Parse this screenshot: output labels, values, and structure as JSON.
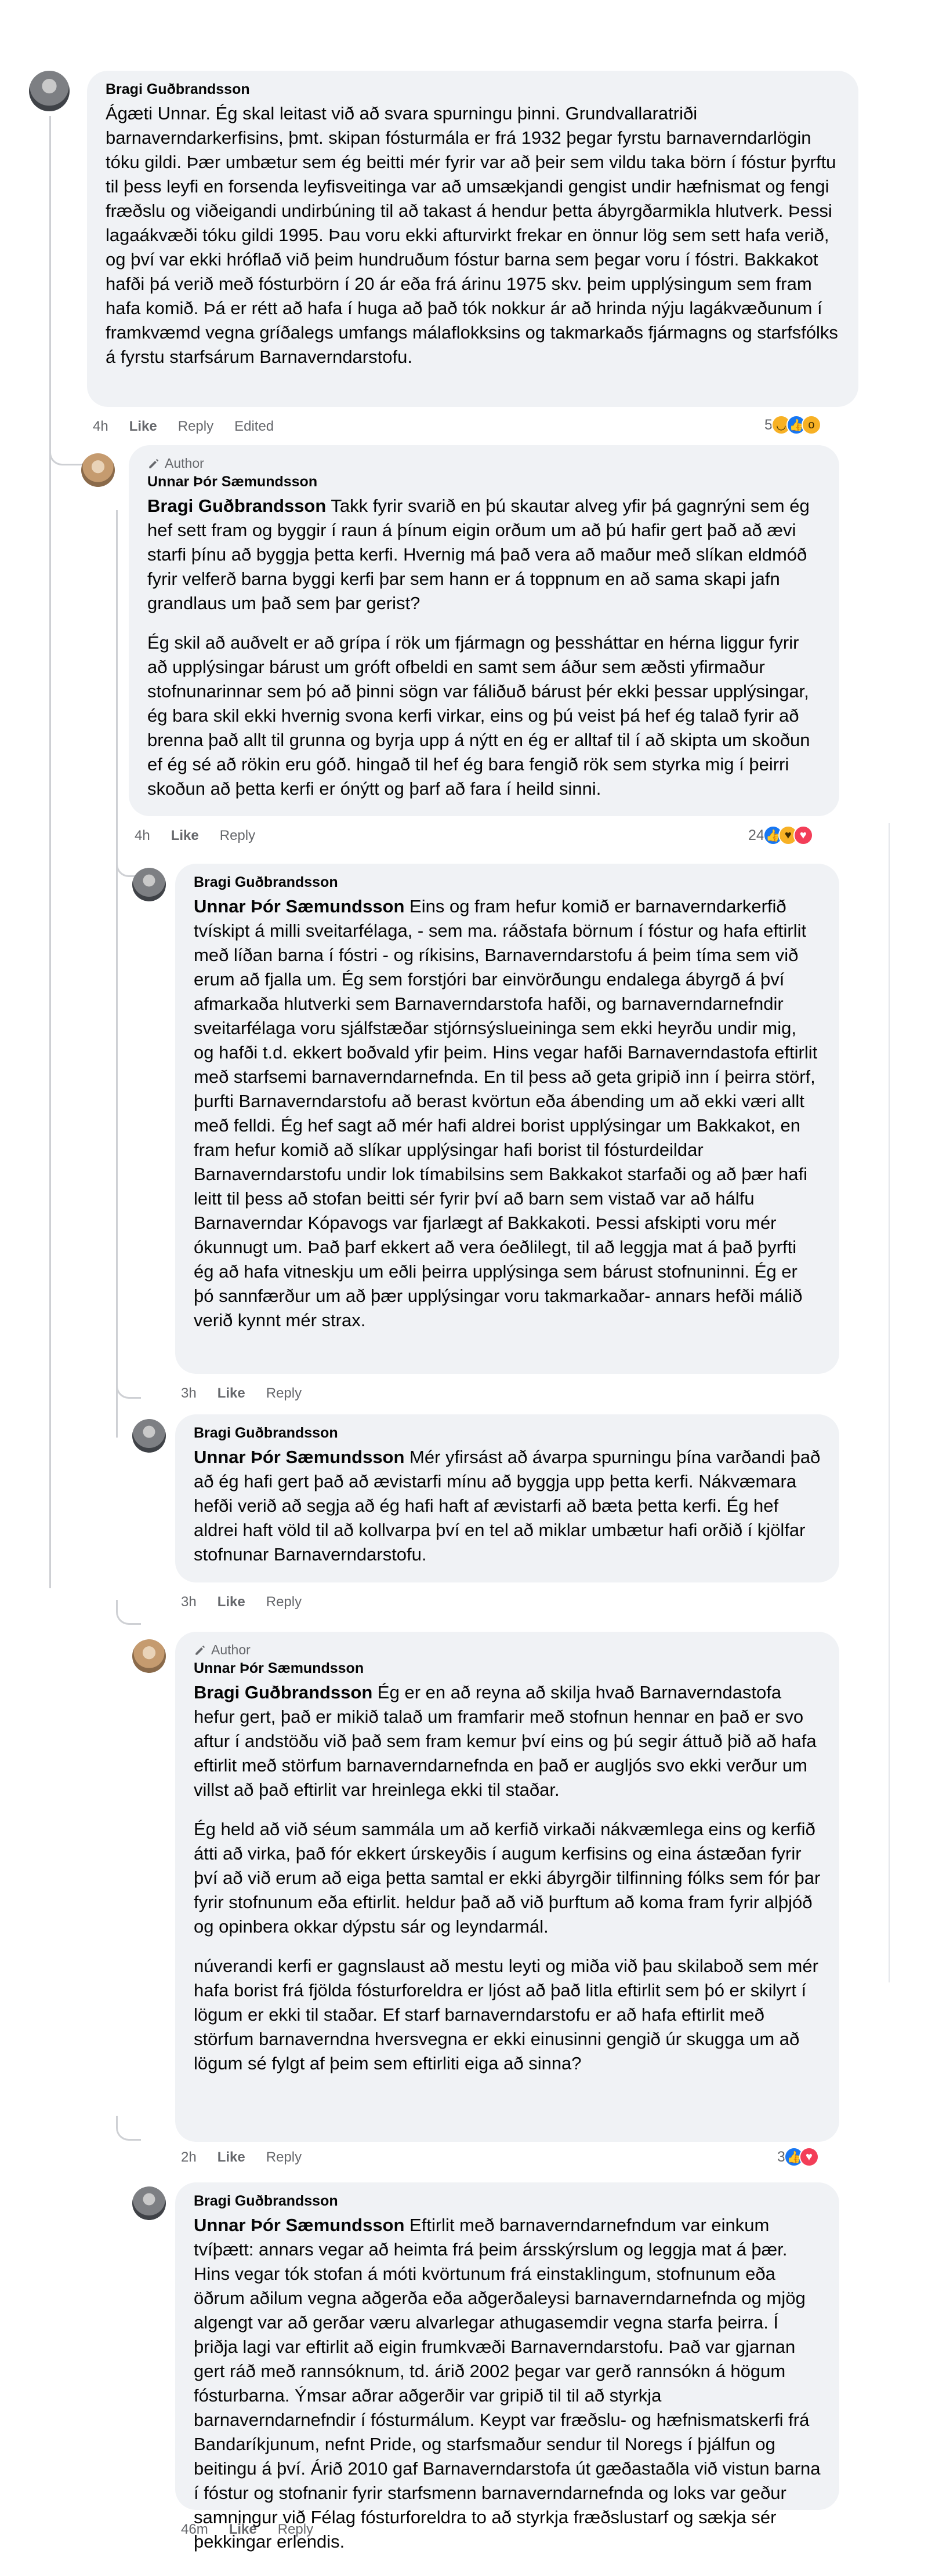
{
  "comments": [
    {
      "author": "Bragi Guðbrandsson",
      "author_badge": "",
      "mention": "",
      "paragraphs": [
        "Ágæti Unnar. Ég skal leitast við að svara spurningu þinni. Grundvallaratriði barnaverndarkerfisins, þmt. skipan fósturmála er frá 1932 þegar fyrstu barnaverndarlögin tóku gildi. Þær umbætur sem ég beitti mér fyrir var að þeir sem vildu taka börn í fóstur þyrftu til þess leyfi en forsenda leyfisveitinga var að umsækjandi gengist undir hæfnismat og fengi fræðslu og viðeigandi undirbúning til að takast á hendur þetta ábyrgðarmikla hlutverk. Þessi lagaákvæði tóku gildi 1995. Þau voru ekki afturvirkt frekar en önnur lög sem sett hafa verið, og því var ekki hróflað við þeim hundruðum fóstur barna sem þegar voru í fóstri. Bakkakot hafði þá verið með fósturbörn í 20 ár eða frá árinu 1975 skv. þeim upplýsingum sem fram hafa komið. Þá er rétt að hafa í huga að það tók nokkur ár að hrinda nýju lagákvæðunum í framkvæmd vegna gríðalegs umfangs málaflokksins og takmarkaðs fjármagns og starfsfólks á fyrstu starfsárum Barnaverndarstofu."
      ],
      "time": "4h",
      "like_label": "Like",
      "reply_label": "Reply",
      "edited_label": "Edited",
      "reaction_count": "5",
      "reactions": [
        "haha",
        "like",
        "wow"
      ]
    },
    {
      "author": "Unnar Þór Sæmundsson",
      "author_badge": "Author",
      "mention": "Bragi Guðbrandsson",
      "paragraphs": [
        " Takk fyrir svarið en þú skautar alveg yfir þá gagnrýni sem ég hef sett fram og byggir í raun á þínum eigin orðum um að þú hafir gert það að ævi starfi þínu að byggja þetta kerfi. Hvernig má það vera að maður með slíkan eldmóð fyrir velferð barna byggi kerfi þar sem hann er á toppnum en að sama skapi jafn grandlaus um það sem þar gerist?",
        "Ég skil að auðvelt er að grípa í rök um fjármagn og þessháttar en hérna liggur fyrir að upplýsingar bárust um gróft ofbeldi en samt sem áður sem æðsti yfirmaður stofnunarinnar sem þó að þinni sögn var fáliðuð bárust þér ekki þessar upplýsingar, ég bara skil ekki hvernig svona kerfi virkar, eins og þú veist þá hef ég talað fyrir að brenna það allt til grunna og byrja upp á nýtt en ég er alltaf til í að skipta um skoðun ef ég sé að rökin eru góð. hingað til hef ég bara fengið rök sem styrka mig í þeirri skoðun að þetta kerfi er ónýtt og þarf að fara í heild sinni."
      ],
      "time": "4h",
      "like_label": "Like",
      "reply_label": "Reply",
      "reaction_count": "24",
      "reactions": [
        "like",
        "care",
        "love"
      ]
    },
    {
      "author": "Bragi Guðbrandsson",
      "author_badge": "",
      "mention": "Unnar Þór Sæmundsson",
      "paragraphs": [
        " Eins og fram hefur komið er barnaverndarkerfið tvískipt á milli sveitarfélaga, - sem ma. ráðstafa börnum í fóstur og hafa eftirlit með líðan barna í fóstri - og ríkisins, Barnaverndarstofu á þeim tíma sem við erum að fjalla um. Ég sem forstjóri bar einvörðungu endalega ábyrgð á því afmarkaða hlutverki sem Barnaverndarstofa hafði, og barnaverndarnefndir sveitarfélaga voru sjálfstæðar stjórnsýslueininga sem ekki heyrðu undir mig, og hafði t.d. ekkert boðvald yfir þeim. Hins vegar hafði Barnaverndastofa eftirlit með starfsemi barnaverndarnefnda. En til þess að geta gripið inn í þeirra störf, þurfti Barnaverndarstofu að berast kvörtun eða ábending um að ekki væri allt með felldi. Ég hef sagt að mér hafi aldrei borist upplýsingar um Bakkakot, en fram hefur komið að slíkar upplýsingar hafi borist til fósturdeildar Barnaverndarstofu undir lok tímabilsins sem Bakkakot starfaði og að þær hafi leitt til þess að stofan beitti sér fyrir því að barn sem vistað var að hálfu Barnaverndar Kópavogs var fjarlægt af Bakkakoti. Þessi afskipti voru mér ókunnugt um. Það þarf ekkert að vera óeðlilegt, til að leggja mat á það þyrfti ég að hafa vitneskju um eðli þeirra upplýsinga sem bárust stofnuninni. Ég er þó sannfærður um að þær upplýsingar voru takmarkaðar- annars hefði málið verið kynnt mér strax."
      ],
      "time": "3h",
      "like_label": "Like",
      "reply_label": "Reply"
    },
    {
      "author": "Bragi Guðbrandsson",
      "author_badge": "",
      "mention": "Unnar Þór Sæmundsson",
      "paragraphs": [
        " Mér yfirsást að ávarpa spurningu þína varðandi það að ég hafi gert það að ævistarfi mínu að byggja upp þetta kerfi. Nákvæmara hefði verið að segja að ég hafi haft af ævistarfi að bæta þetta kerfi. Ég hef aldrei haft völd til að kollvarpa því en tel að miklar umbætur hafi orðið í kjölfar stofnunar Barnaverndarstofu."
      ],
      "time": "3h",
      "like_label": "Like",
      "reply_label": "Reply"
    },
    {
      "author": "Unnar Þór Sæmundsson",
      "author_badge": "Author",
      "mention": "Bragi Guðbrandsson",
      "paragraphs": [
        " Ég er en að reyna að skilja hvað Barnaverndastofa hefur gert, það er mikið talað um framfarir með stofnun hennar en það er svo aftur í andstöðu við það sem fram kemur því eins og þú segir áttuð þið að hafa eftirlit með störfum barnaverndarnefnda en það er augljós svo ekki verður um villst að það eftirlit var hreinlega ekki til staðar.",
        "Ég held að við séum sammála um að kerfið virkaði nákvæmlega eins og kerfið átti að virka, það fór ekkert úrskeyðis í augum kerfisins og eina ástæðan fyrir því að við erum að eiga þetta samtal er ekki ábyrgðir tilfinning fólks sem fór þar fyrir stofnunum eða eftirlit. heldur það að við þurftum að koma fram fyrir alþjóð og opinbera okkar dýpstu sár og leyndarmál.",
        "núverandi kerfi er gagnslaust að mestu leyti og miða við þau skilaboð sem mér hafa borist frá fjölda fósturforeldra er ljóst að það litla eftirlit sem þó er skilyrt í lögum er ekki til staðar. Ef starf barnaverndarstofu er að hafa eftirlit með störfum barnaverndna hversvegna er ekki einusinni gengið úr skugga um að lögum sé fylgt af þeim sem eftirliti eiga að sinna?"
      ],
      "time": "2h",
      "like_label": "Like",
      "reply_label": "Reply",
      "reaction_count": "3",
      "reactions": [
        "like",
        "love"
      ]
    },
    {
      "author": "Bragi Guðbrandsson",
      "author_badge": "",
      "mention": "Unnar Þór Sæmundsson",
      "paragraphs": [
        " Eftirlit með barnaverndarnefndum var einkum tvíþætt: annars vegar að heimta frá þeim ársskýrslum og leggja mat á þær. Hins vegar tók stofan á móti kvörtunum frá einstaklingum, stofnunum eða öðrum aðilum vegna aðgerða eða aðgerðaleysi barnaverndarnefnda og mjög algengt var að gerðar væru alvarlegar athugasemdir vegna starfa þeirra. Í þriðja lagi var eftirlit að eigin frumkvæði Barnaverndarstofu. Það var gjarnan gert ráð með rannsóknum, td. árið 2002 þegar var gerð rannsókn á högum fósturbarna. Ýmsar aðrar aðgerðir var gripið til til að styrkja barnaverndarnefndir í fósturmálum. Keypt var fræðslu- og hæfnismatskerfi frá Bandaríkjunum, nefnt Pride, og starfsmaður sendur til Noregs í þjálfun og beitingu á því. Árið 2010 gaf Barnaverndarstofa út gæðastaðla við vistun barna í fóstur og stofnanir fyrir starfsmenn barnaverndarnefnda og loks var geður samningur við Félag fósturforeldra to að styrkja fræðslustarf og sækja sér þekkingar erlendis."
      ],
      "time": "46m",
      "like_label": "Like",
      "reply_label": "Reply"
    }
  ]
}
